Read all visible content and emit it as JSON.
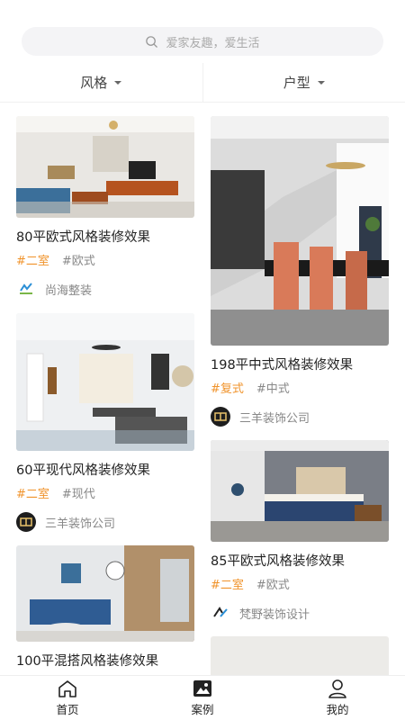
{
  "search": {
    "placeholder": "爱家友趣，爱生活"
  },
  "filters": [
    {
      "label": "风格"
    },
    {
      "label": "户型"
    }
  ],
  "cards_left": [
    {
      "title": "80平欧式风格装修效果",
      "tag1": "#二室",
      "tag2": "#欧式",
      "company": "尚海整装"
    },
    {
      "title": "60平现代风格装修效果",
      "tag1": "#二室",
      "tag2": "#现代",
      "company": "三羊装饰公司"
    },
    {
      "title": "100平混搭风格装修效果"
    }
  ],
  "cards_right": [
    {
      "title": "198平中式风格装修效果",
      "tag1": "#复式",
      "tag2": "#中式",
      "company": "三羊装饰公司"
    },
    {
      "title": "85平欧式风格装修效果",
      "tag1": "#二室",
      "tag2": "#欧式",
      "company": "梵野装饰设计"
    }
  ],
  "tabbar": [
    {
      "label": "首页"
    },
    {
      "label": "案例"
    },
    {
      "label": "我的"
    }
  ],
  "colors": {
    "accent": "#f0932b",
    "muted": "#888888",
    "search_bg": "#f4f4f6"
  }
}
